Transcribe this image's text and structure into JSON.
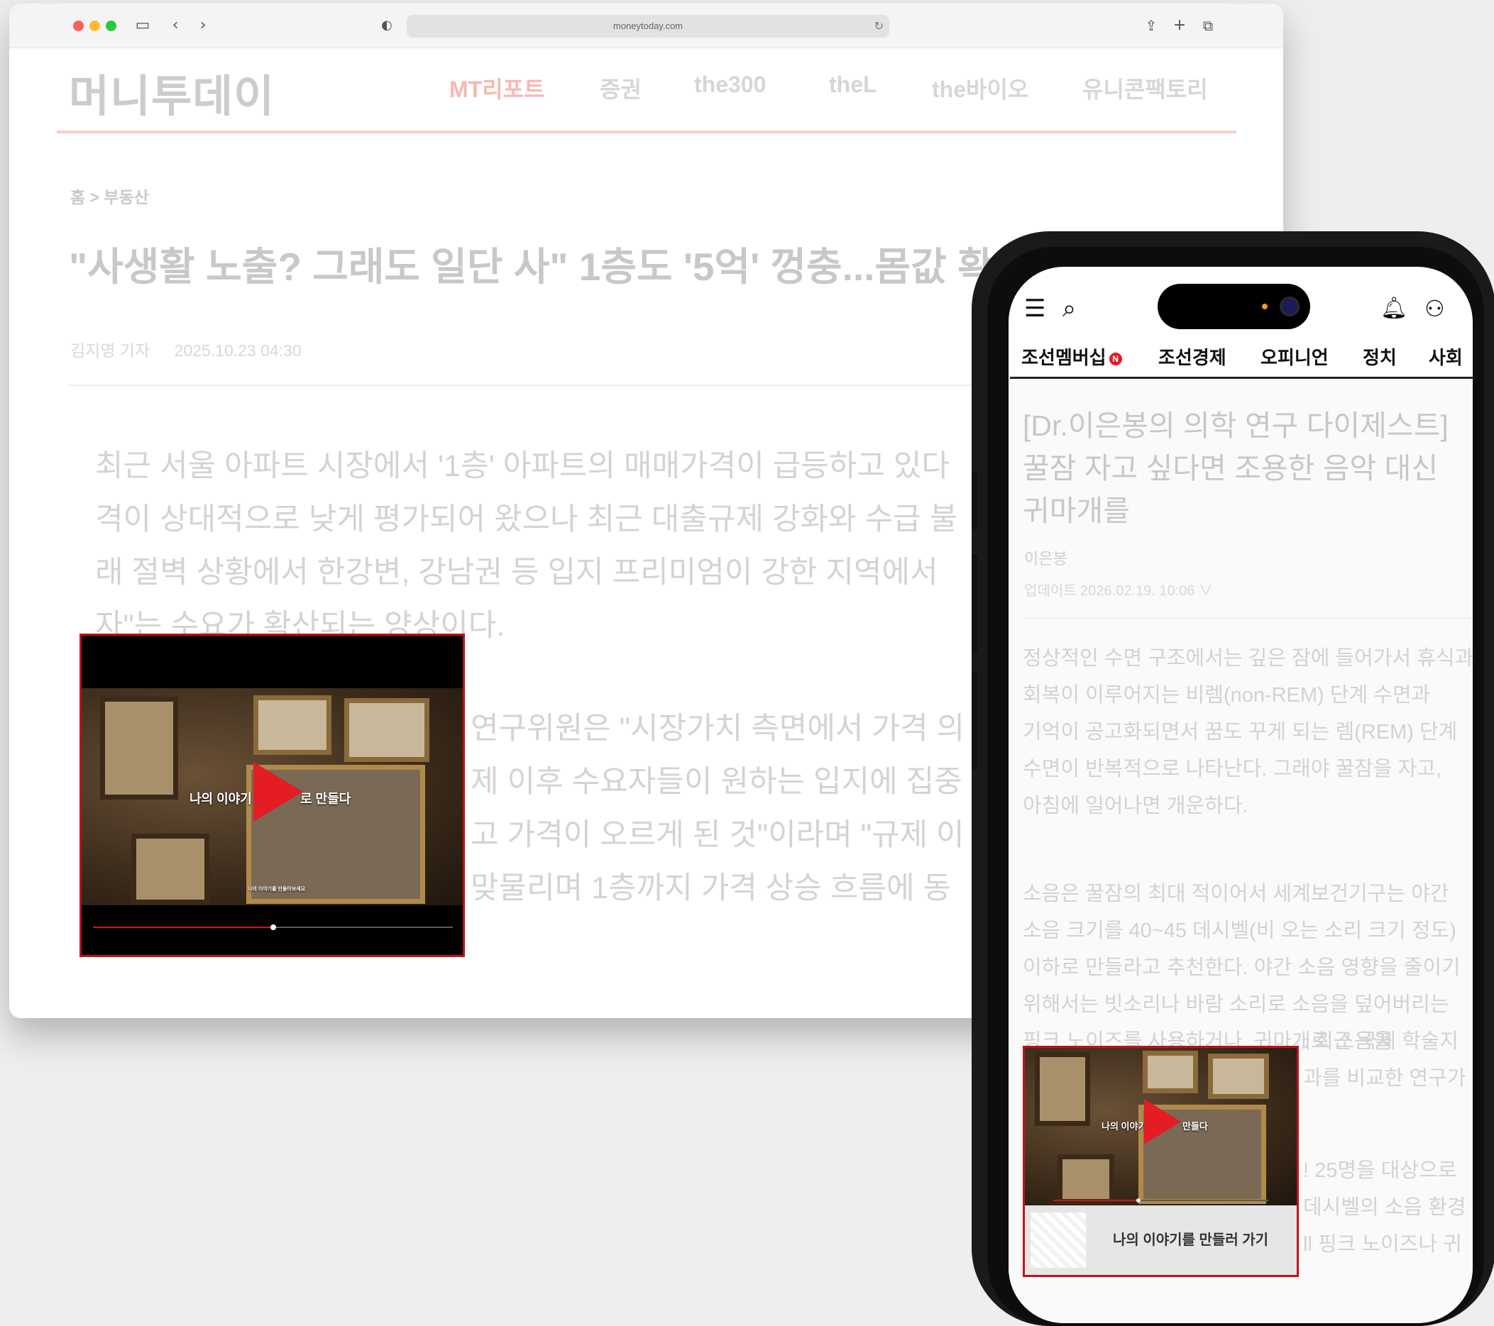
{
  "desktop": {
    "url": "moneytoday.com",
    "site_logo": "머니투데이",
    "nav": [
      "MT리포트",
      "증권",
      "the300",
      "theL",
      "the바이오",
      "유니콘팩토리"
    ],
    "breadcrumb": "홈 > 부동산",
    "headline": "\"사생활 노출? 그래도 일단 사\" 1층도 '5억' 껑충...몸값 확",
    "byline": {
      "author": "김지영 기자",
      "date": "2025.10.23 04:30"
    },
    "paragraph1": "최근 서울 아파트 시장에서 '1층' 아파트의 매매가격이 급등하고 있다 격이 상대적으로 낮게 평가되어 왔으나 최근 대출규제 강화와 수급 불 래 절벽 상황에서 한강변, 강남권 등 입지 프리미엄이 강한 지역에서 자\"는 수요가 확산되는 양상이다.",
    "paragraph2": "연구위원은 \"시장가치 측면에서 가격 의 제 이후 수요자들이 원하는 입지에 집중 고 가격이 오르게 된 것\"이라며 \"규제 이 맞물리며 1층까지 가격 상승 흐름에 동",
    "video": {
      "overlay_text_left": "나의 이야기",
      "overlay_text_right": "로 만들다",
      "caption": "나의 이야기를 만들어보세요",
      "progress": 0.5
    }
  },
  "phone": {
    "tabs": [
      "조선멤버십",
      "조선경제",
      "오피니언",
      "정치",
      "사회"
    ],
    "badge": "N",
    "headline": "[Dr.이은봉의 의학 연구 다이제스트] 꿀잠 자고 싶다면 조용한 음악 대신 귀마개를",
    "author": "이은봉",
    "date": "업데이트 2026.02.19. 10:06 ∨",
    "paragraph1": "정상적인 수면 구조에서는 깊은 잠에 들어가서 휴식과 회복이 이루어지는 비렘(non-REM) 단계 수면과 기억이 공고화되면서 꿈도 꾸게 되는 렘(REM) 단계 수면이 반복적으로 나타난다. 그래야 꿀잠을 자고, 아침에 일어나면 개운하다.",
    "paragraph2": "소음은 꿀잠의 최대 적이어서 세계보건기구는 야간 소음 크기를 40~45 데시벨(비 오는 소리 크기 정도) 이하로 만들라고 추천한다. 야간 소음 영향을 줄이기 위해서는 빗소리나 바람 소리로 소음을 덮어버리는 핑크 노이즈를 사용하거나, 귀마개로 소음을",
    "paragraph2_tail": [
      ". 최근 국제 학술지",
      "과를 비교한 연구가"
    ],
    "paragraph3_tail": [
      "! 25명을 대상으로",
      "데시벨의 소음 환경",
      "ll 핑크 노이즈나 귀"
    ],
    "video": {
      "overlay_text_left": "나의 이야기",
      "overlay_text_right": "만들다",
      "cta_label": "나의 이야기를 만들러 가기",
      "progress": 0.4
    }
  },
  "colors": {
    "accent": "#e41c24",
    "video_border": "#c1121a"
  }
}
